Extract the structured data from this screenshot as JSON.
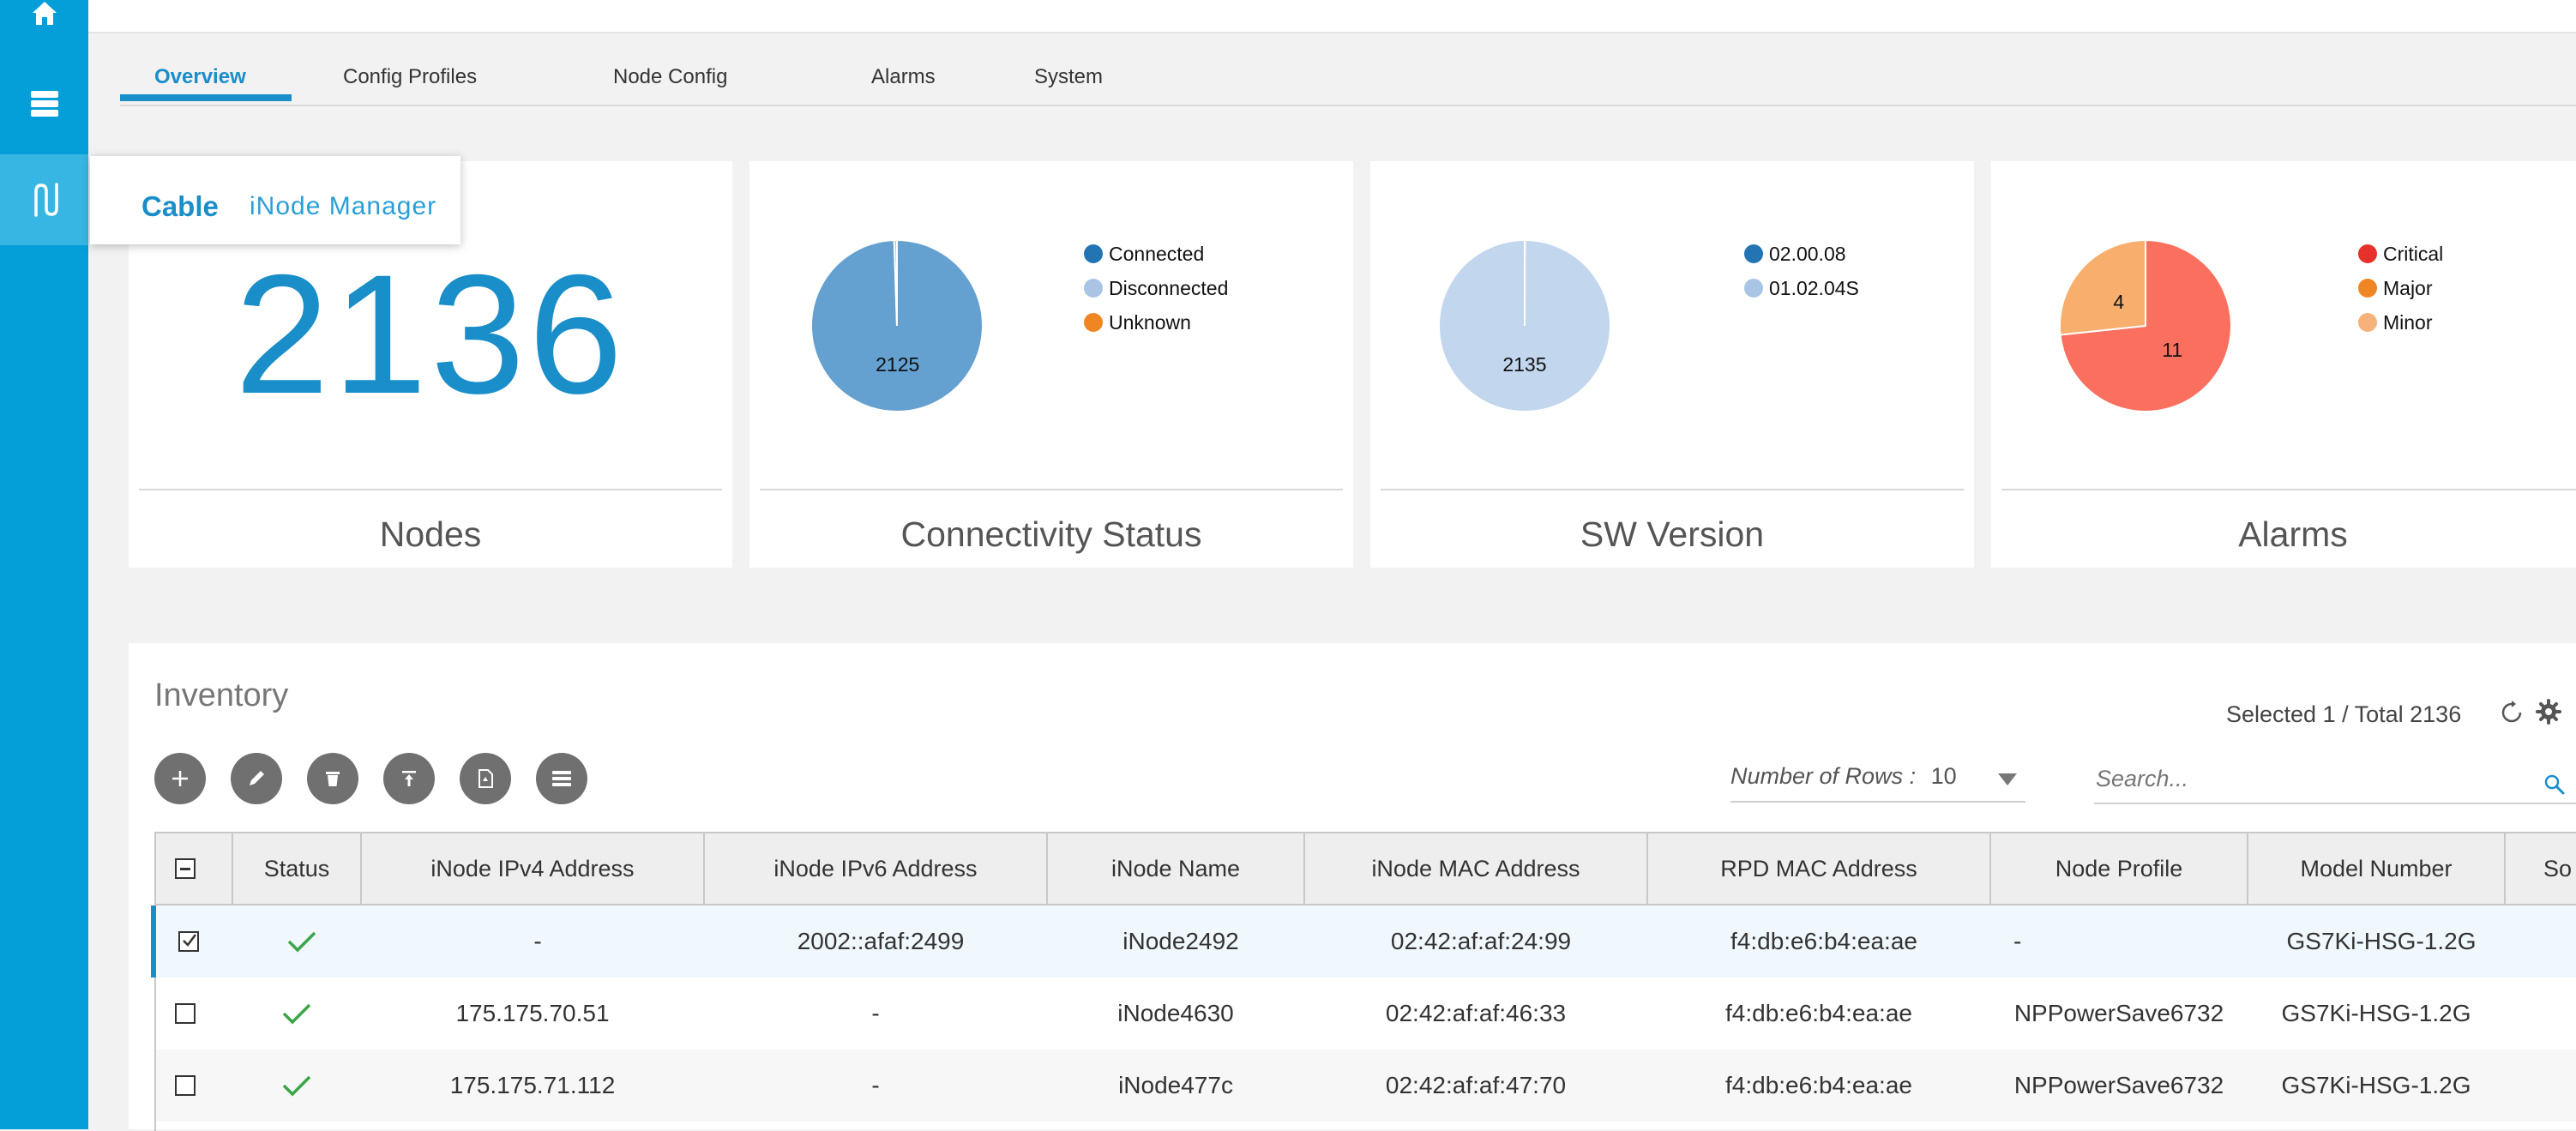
{
  "nav": {
    "items": [
      {
        "name": "home-icon"
      },
      {
        "name": "database-icon"
      },
      {
        "name": "cable-icon",
        "active": true
      }
    ],
    "popover": {
      "cable": "Cable",
      "inode": "iNode Manager"
    }
  },
  "topbar": {
    "left_fragment": "",
    "right_fragment": ""
  },
  "tabs": [
    "Overview",
    "Config Profiles",
    "Node Config",
    "Alarms",
    "System"
  ],
  "cards": {
    "nodes": {
      "value": "2136",
      "title": "Nodes"
    },
    "connectivity": {
      "title": "Connectivity Status",
      "legend": [
        "Connected",
        "Disconnected",
        "Unknown"
      ],
      "colors": [
        "#2274b3",
        "#a9c4e4",
        "#f08524"
      ]
    },
    "sw_version": {
      "title": "SW Version",
      "legend": [
        "02.00.08",
        "01.02.04S"
      ],
      "colors": [
        "#2274b3",
        "#a9c4e4"
      ]
    },
    "alarms": {
      "title": "Alarms",
      "legend": [
        "Critical",
        "Major",
        "Minor"
      ],
      "colors": [
        "#e5312a",
        "#f08524",
        "#f6b27a"
      ]
    }
  },
  "chart_data": [
    {
      "type": "pie",
      "title": "Connectivity Status",
      "categories": [
        "Connected",
        "Disconnected",
        "Unknown"
      ],
      "values": [
        2125,
        11,
        0
      ],
      "labels": [
        "2125",
        "",
        ""
      ],
      "slice_colors": [
        "#64a0d0",
        "#a9c4e4",
        "#f08524"
      ],
      "legend": "top-right"
    },
    {
      "type": "pie",
      "title": "SW Version",
      "categories": [
        "02.00.08",
        "01.02.04S"
      ],
      "values": [
        1,
        2135
      ],
      "labels": [
        "",
        "2135"
      ],
      "slice_colors": [
        "#2274b3",
        "#c2d6ee"
      ],
      "legend": "top-right"
    },
    {
      "type": "pie",
      "title": "Alarms",
      "categories": [
        "Critical",
        "Major",
        "Minor"
      ],
      "values": [
        11,
        0,
        4
      ],
      "labels": [
        "11",
        "",
        "4"
      ],
      "slice_colors": [
        "#fb6f5e",
        "#f08524",
        "#f8ae6c"
      ],
      "legend": "top-right"
    }
  ],
  "inventory": {
    "title": "Inventory",
    "selected_info": "Selected 1 / Total 2136",
    "rows_label": "Number of Rows :",
    "rows_value": "10",
    "search_placeholder": "Search...",
    "toolbar": [
      "add-icon",
      "edit-icon",
      "delete-icon",
      "upload-icon",
      "export-icon",
      "list-icon"
    ],
    "columns": [
      "Status",
      "iNode IPv4 Address",
      "iNode IPv6 Address",
      "iNode Name",
      "iNode MAC Address",
      "RPD MAC Address",
      "Node Profile",
      "Model Number",
      "So"
    ],
    "rows": [
      {
        "checked": true,
        "status": "ok",
        "ipv4": "-",
        "ipv6": "2002::afaf:2499",
        "name": "iNode2492",
        "mac": "02:42:af:af:24:99",
        "rpd": "f4:db:e6:b4:ea:ae",
        "profile": "-",
        "model": "GS7Ki-HSG-1.2G"
      },
      {
        "checked": false,
        "status": "ok",
        "ipv4": "175.175.70.51",
        "ipv6": "-",
        "name": "iNode4630",
        "mac": "02:42:af:af:46:33",
        "rpd": "f4:db:e6:b4:ea:ae",
        "profile": "NPPowerSave6732",
        "model": "GS7Ki-HSG-1.2G"
      },
      {
        "checked": false,
        "status": "ok",
        "ipv4": "175.175.71.112",
        "ipv6": "-",
        "name": "iNode477c",
        "mac": "02:42:af:af:47:70",
        "rpd": "f4:db:e6:b4:ea:ae",
        "profile": "NPPowerSave6732",
        "model": "GS7Ki-HSG-1.2G"
      }
    ]
  }
}
